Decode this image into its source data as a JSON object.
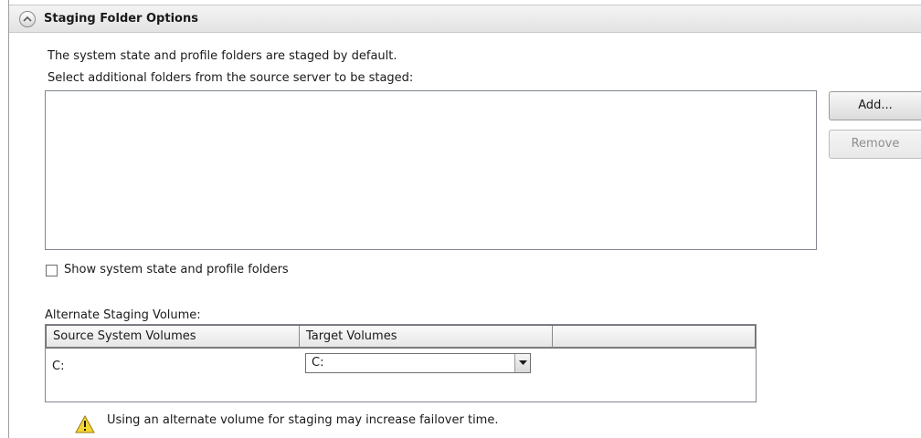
{
  "section": {
    "title": "Staging Folder Options",
    "collapse_icon": "chevron-up-icon"
  },
  "info": {
    "line1": "The system state and profile folders are staged by default.",
    "line2": "Select additional folders from the source server to be staged:"
  },
  "buttons": {
    "add_label": "Add...",
    "remove_label": "Remove"
  },
  "checkbox": {
    "label": "Show system state and profile folders",
    "checked": false
  },
  "alternate": {
    "label": "Alternate Staging Volume:",
    "columns": [
      "Source System Volumes",
      "Target Volumes",
      ""
    ],
    "rows": [
      {
        "source": "C:",
        "target": "C:"
      }
    ]
  },
  "warning": {
    "icon": "warning-icon",
    "text": "Using an alternate volume for staging may increase failover time."
  }
}
